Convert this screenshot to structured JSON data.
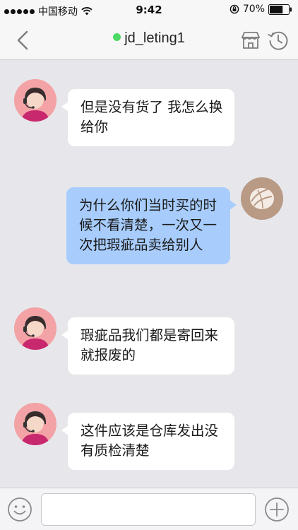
{
  "status_bar": {
    "carrier": "中国移动",
    "time": "9:42",
    "battery": "70%",
    "battery_level": 0.7
  },
  "nav": {
    "title": "jd_leting1",
    "status_color": "#4cd964"
  },
  "messages": [
    {
      "sender": "agent",
      "text": "但是没有货了 我怎么换给你"
    },
    {
      "sender": "user",
      "text": "为什么你们当时买的时候不看清楚，一次又一次把瑕疵品卖给别人"
    },
    {
      "sender": "agent",
      "text": "瑕疵品我们都是寄回来就报废的"
    },
    {
      "sender": "agent",
      "text": "这件应该是仓库发出没有质检清楚"
    }
  ],
  "input": {
    "value": "",
    "placeholder": ""
  },
  "colors": {
    "user_bubble": "#a8cdfd",
    "agent_bubble": "#ffffff",
    "background": "#e7e7eb"
  },
  "icons": [
    "back-icon",
    "wifi-icon",
    "lock-rotation-icon",
    "battery-icon",
    "store-icon",
    "history-clock-icon",
    "emoji-icon",
    "plus-icon"
  ]
}
